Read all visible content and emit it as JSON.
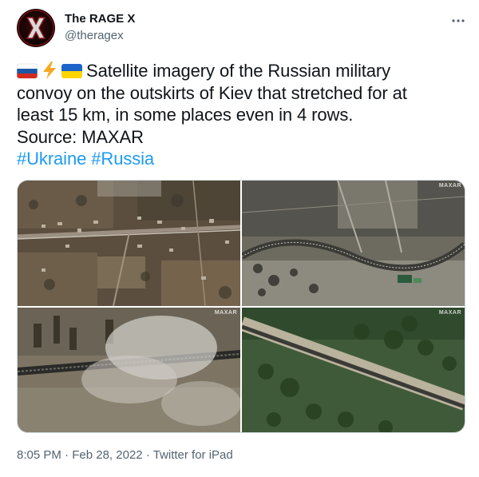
{
  "author": {
    "display_name": "The RAGE X",
    "handle": "@theragex",
    "avatar_icon": "x-logo-avatar"
  },
  "more_icon": "ellipsis-icon",
  "tweet": {
    "line1": "Satellite imagery of the Russian military",
    "line2": "convoy on the outskirts of Kiev that stretched for at",
    "line3": "least 15 km, in some places even in 4 rows.",
    "line4": "Source: MAXAR",
    "hashtags": [
      "#Ukraine",
      "#Russia"
    ],
    "emoji": [
      "russia-flag-icon",
      "lightning-icon",
      "ukraine-flag-icon"
    ]
  },
  "media": {
    "watermark": "MAXAR",
    "images": [
      "satellite-image-village",
      "satellite-image-convoy-road",
      "satellite-image-convoy-smoke",
      "satellite-image-convoy-forest"
    ]
  },
  "footer": {
    "time": "8:05 PM",
    "sep1": " · ",
    "date": "Feb 28, 2022",
    "sep2": " · ",
    "source": "Twitter for iPad"
  },
  "colors": {
    "link": "#1d9bf0",
    "secondary_text": "#536471",
    "border": "#cfd9de"
  }
}
